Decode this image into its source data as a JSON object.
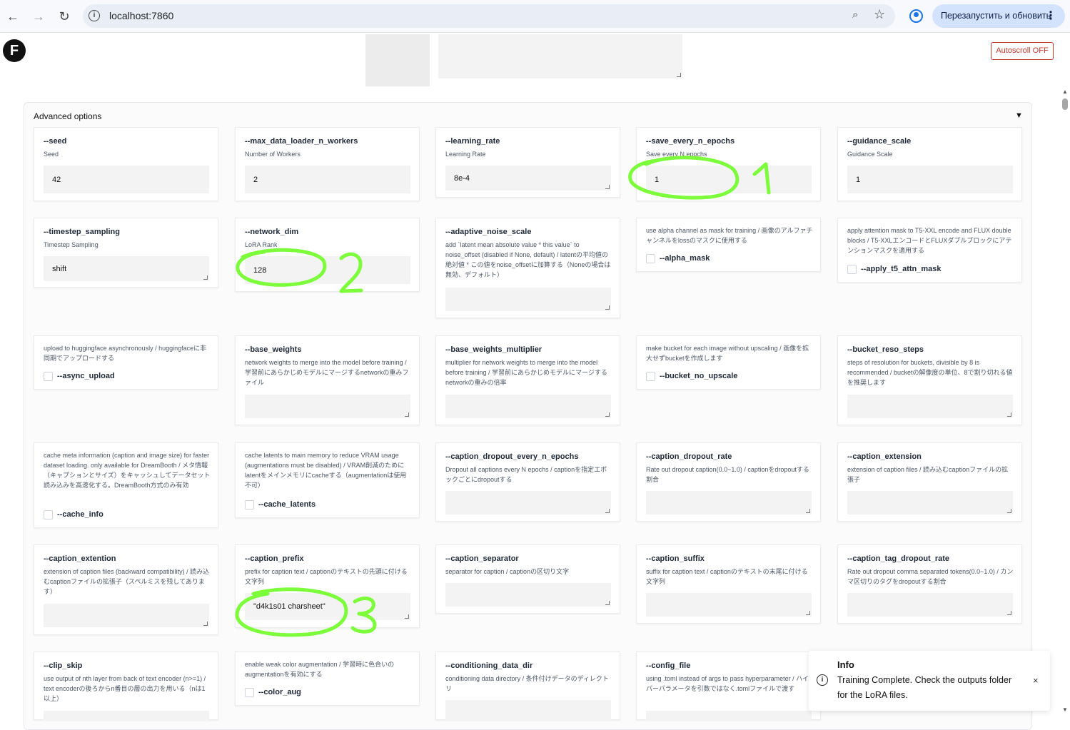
{
  "browser": {
    "url": "localhost:7860",
    "relaunch_label": "Перезапустить и обновить",
    "back_icon": "←",
    "forward_icon": "→",
    "reload_icon": "↻",
    "zoom_icon": "⌕",
    "star_icon": "☆",
    "menu_icon": "⋮"
  },
  "page": {
    "logo_letter": "F",
    "autoscroll_label": "Autoscroll OFF"
  },
  "accordion": {
    "title": "Advanced options",
    "caret": "▼"
  },
  "fields": {
    "seed": {
      "label": "--seed",
      "desc": "Seed",
      "value": "42"
    },
    "max_workers": {
      "label": "--max_data_loader_n_workers",
      "desc": "Number of Workers",
      "value": "2"
    },
    "learning_rate": {
      "label": "--learning_rate",
      "desc": "Learning Rate",
      "value": "8e-4"
    },
    "save_every": {
      "label": "--save_every_n_epochs",
      "desc": "Save every N epochs",
      "value": "1"
    },
    "guidance": {
      "label": "--guidance_scale",
      "desc": "Guidance Scale",
      "value": "1"
    },
    "timestep": {
      "label": "--timestep_sampling",
      "desc": "Timestep Sampling",
      "value": "shift"
    },
    "network_dim": {
      "label": "--network_dim",
      "desc": "LoRA Rank",
      "value": "128"
    },
    "adaptive_noise": {
      "label": "--adaptive_noise_scale",
      "desc": "add `latent mean absolute value * this value` to noise_offset (disabled if None, default) / latentの平均値の絶対値 * この値をnoise_offsetに加算する（Noneの場合は無効、デフォルト）",
      "value": ""
    },
    "alpha_mask": {
      "desc": "use alpha channel as mask for training / 画像のアルファチャンネルをlossのマスクに使用する",
      "label": "--alpha_mask"
    },
    "t5_attn": {
      "desc": "apply attention mask to T5-XXL encode and FLUX double blocks / T5-XXLエンコードとFLUXダブルブロックにアテンションマスクを適用する",
      "label": "--apply_t5_attn_mask"
    },
    "async_upload": {
      "desc": "upload to huggingface asynchronously / huggingfaceに非同期でアップロードする",
      "label": "--async_upload"
    },
    "base_weights": {
      "label": "--base_weights",
      "desc": "network weights to merge into the model before training / 学習前にあらかじめモデルにマージするnetworkの重みファイル",
      "value": ""
    },
    "base_weights_mult": {
      "label": "--base_weights_multiplier",
      "desc": "multiplier for network weights to merge into the model before training / 学習前にあらかじめモデルにマージするnetworkの重みの倍率",
      "value": ""
    },
    "bucket_no_upscale": {
      "desc": "make bucket for each image without upscaling / 画像を拡大せずbucketを作成します",
      "label": "--bucket_no_upscale"
    },
    "bucket_reso": {
      "label": "--bucket_reso_steps",
      "desc": "steps of resolution for buckets, divisible by 8 is recommended / bucketの解像度の単位、8で割り切れる値を推奨します",
      "value": ""
    },
    "cache_info": {
      "desc": "cache meta information (caption and image size) for faster dataset loading. only available for DreamBooth / メタ情報（キャプションとサイズ）をキャッシュしてデータセット読み込みを高速化する。DreamBooth方式のみ有効",
      "label": "--cache_info"
    },
    "cache_latents": {
      "desc": "cache latents to main memory to reduce VRAM usage (augmentations must be disabled) / VRAM削減のためにlatentをメインメモリにcacheする（augmentationは使用不可）",
      "label": "--cache_latents"
    },
    "caption_dropout_epochs": {
      "label": "--caption_dropout_every_n_epochs",
      "desc": "Dropout all captions every N epochs / captionを指定エポックごとにdropoutする",
      "value": ""
    },
    "caption_dropout_rate": {
      "label": "--caption_dropout_rate",
      "desc": "Rate out dropout caption(0.0~1.0) / captionをdropoutする割合",
      "value": ""
    },
    "caption_extension": {
      "label": "--caption_extension",
      "desc": "extension of caption files / 読み込むcaptionファイルの拡張子",
      "value": ""
    },
    "caption_extention": {
      "label": "--caption_extention",
      "desc": "extension of caption files (backward compatibility) / 読み込むcaptionファイルの拡張子（スペルミスを残してあります）",
      "value": ""
    },
    "caption_prefix": {
      "label": "--caption_prefix",
      "desc": "prefix for caption text / captionのテキストの先頭に付ける文字列",
      "value": "\"d4k1s01 charsheet\""
    },
    "caption_separator": {
      "label": "--caption_separator",
      "desc": "separator for caption / captionの区切り文字",
      "value": ""
    },
    "caption_suffix": {
      "label": "--caption_suffix",
      "desc": "suffix for caption text / captionのテキストの末尾に付ける文字列",
      "value": ""
    },
    "caption_tag_dropout": {
      "label": "--caption_tag_dropout_rate",
      "desc": "Rate out dropout comma separated tokens(0.0~1.0) / カンマ区切りのタグをdropoutする割合",
      "value": ""
    },
    "clip_skip": {
      "label": "--clip_skip",
      "desc": "use output of nth layer from back of text encoder (n>=1) / text encoderの後ろからn番目の層の出力を用いる（nは1以上）",
      "value": ""
    },
    "color_aug": {
      "desc": "enable weak color augmentation / 学習時に色合いのaugmentationを有効にする",
      "label": "--color_aug"
    },
    "conditioning_dir": {
      "label": "--conditioning_data_dir",
      "desc": "conditioning data directory / 条件付けデータのディレクトリ",
      "value": ""
    },
    "config_file": {
      "label": "--config_file",
      "desc": "using .toml instead of args to pass hyperparameter / ハイパーパラメータを引数ではなく.tomlファイルで渡す",
      "value": ""
    }
  },
  "toast": {
    "title": "Info",
    "message": "Training Complete. Check the outputs folder for the LoRA files.",
    "close": "×",
    "icon": "i"
  },
  "annotations": {
    "color": "#7CFC3A",
    "marks": [
      "1",
      "2",
      "3"
    ]
  }
}
